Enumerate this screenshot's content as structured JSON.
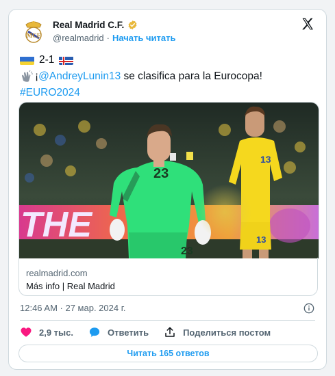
{
  "account": {
    "name": "Real Madrid C.F.",
    "handle": "@realmadrid",
    "separator": "·",
    "follow_label": "Начать читать"
  },
  "tweet": {
    "score": "2-1",
    "line2_prefix": "¡",
    "mention": "@AndreyLunin13",
    "line2_suffix": " se clasifica para la Eurocopa!",
    "hashtag": "#EURO2024"
  },
  "media": {
    "player_number_left": "23",
    "player_number_right": "13",
    "banner_text": "THE"
  },
  "link_card": {
    "domain": "realmadrid.com",
    "title": "Más info | Real Madrid"
  },
  "timestamp": "12:46 AM · 27 мар. 2024 г.",
  "actions": {
    "likes": "2,9 тыс.",
    "reply_label": "Ответить",
    "share_label": "Поделиться постом"
  },
  "replies_button": "Читать 165 ответов",
  "colors": {
    "accent": "#1d9bf0",
    "like": "#f91880",
    "verified": "#e8b83a",
    "text": "#0f1419",
    "muted": "#536471",
    "border": "#cfd9de"
  },
  "icons": [
    "real-madrid-crest",
    "verified-badge",
    "x-logo",
    "ukraine-flag",
    "iceland-flag",
    "clapping-hands-emoji",
    "info-icon",
    "heart-icon",
    "reply-bubble-icon",
    "share-icon"
  ]
}
